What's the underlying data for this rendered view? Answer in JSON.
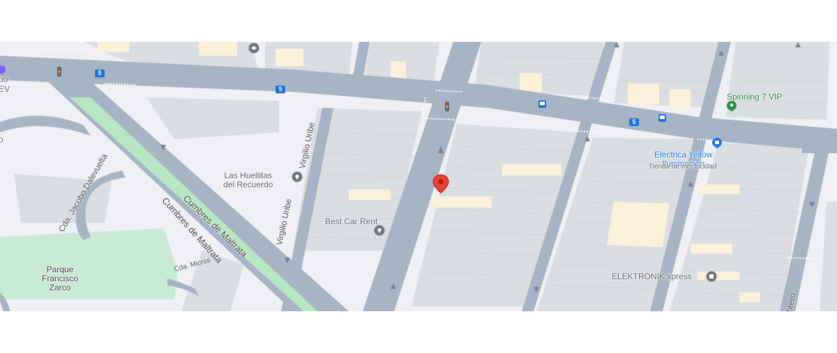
{
  "map": {
    "title_partial_left_1": "bo",
    "title_partial_left_2": "EV",
    "title_partial_left_3": "o",
    "route_sign": "5",
    "streets": {
      "virgilio_uribe_1": "Virgilio Uribe",
      "virgilio_uribe_2": "Virgilio Uribe",
      "cumbres_1": "Cumbres de Maltrata",
      "cumbres_2": "Cumbres de Maltrata",
      "jacobo": "Cda. Jacobo Dalevuelta",
      "micros": "Cda. Micros",
      "febrero": "Febrero"
    },
    "places": {
      "huellitas": "Las Huellitas\ndel Recuerdo",
      "best_car_rent": "Best Car Rent",
      "parque": "Parque\nFrancisco\nZarco",
      "spinning": "Spinning 7 VIP",
      "electrica_name": "Eléctrica Yellow\nIluminación",
      "electrica_sub": "Tienda de electricidad",
      "elektronik": "ELEKTRONIK xpress"
    },
    "colors": {
      "background": "#eef0f3",
      "road": "#a7b4c4",
      "block": "#dadde2",
      "yellow_block": "#faf1d8",
      "park": "#c9ebd6",
      "median": "#b8e6c2",
      "marker": "#ea4335",
      "poi_grey": "#70757a",
      "poi_green": "#1e8e3e",
      "poi_blue": "#1a73e8"
    },
    "icons": {
      "marker": "location-marker-icon",
      "poi": "place-pin-icon",
      "bus": "bus-stop-icon",
      "traffic_light": "traffic-light-icon",
      "shop": "shop-icon",
      "gym": "gym-icon"
    }
  }
}
